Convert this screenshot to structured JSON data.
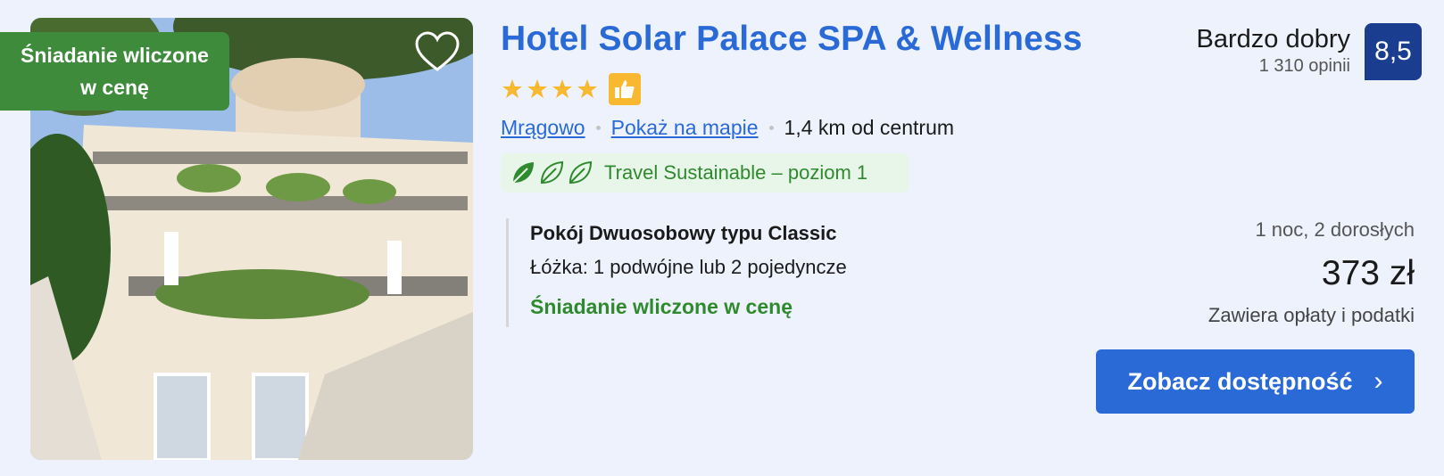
{
  "photo": {
    "badge": "Śniadanie wliczone w cenę",
    "alt_icon": "heart-outline-icon"
  },
  "hotel": {
    "name": "Hotel Solar Palace SPA & Wellness",
    "stars": 4,
    "preferred_icon": "thumbs-up-icon",
    "city": "Mrągowo",
    "map_link": "Pokaż na mapie",
    "distance": "1,4 km od centrum",
    "sustainability": "Travel Sustainable – poziom 1"
  },
  "review": {
    "word": "Bardzo dobry",
    "count": "1 310 opinii",
    "score": "8,5"
  },
  "room": {
    "name": "Pokój Dwuosobowy typu Classic",
    "beds": "Łóżka: 1 podwójne lub 2 pojedyncze",
    "breakfast": "Śniadanie wliczone w cenę"
  },
  "pricing": {
    "stay": "1 noc, 2 dorosłych",
    "price": "373 zł",
    "taxes": "Zawiera opłaty i podatki"
  },
  "cta": {
    "label": "Zobacz dostępność",
    "icon": "chevron-right-icon"
  },
  "colors": {
    "accent": "#2a6ad6",
    "score_bg": "#1a3d8f",
    "green": "#3e8b3c",
    "star": "#f8b830"
  }
}
